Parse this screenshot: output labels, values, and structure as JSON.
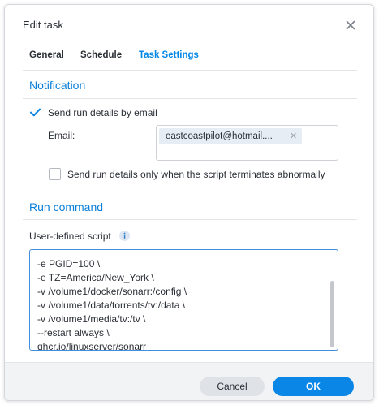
{
  "dialog": {
    "title": "Edit task"
  },
  "tabs": [
    {
      "label": "General",
      "active": false
    },
    {
      "label": "Schedule",
      "active": false
    },
    {
      "label": "Task Settings",
      "active": true
    }
  ],
  "notification": {
    "section_title": "Notification",
    "send_email_label": "Send run details by email",
    "send_email_checked": true,
    "email_label": "Email:",
    "email_chip": "eastcoastpilot@hotmail....",
    "abnormal_label": "Send run details only when the script terminates abnormally",
    "abnormal_checked": false
  },
  "run_command": {
    "section_title": "Run command",
    "script_label": "User-defined script",
    "script_lines": [
      "-e PGID=100 \\",
      "-e TZ=America/New_York \\",
      "-v /volume1/docker/sonarr:/config \\",
      "-v /volume1/data/torrents/tv:/data \\",
      "-v /volume1/media/tv:/tv \\",
      "--restart always \\",
      "ghcr.io/linuxserver/sonarr"
    ]
  },
  "footer": {
    "cancel_label": "Cancel",
    "ok_label": "OK"
  },
  "colors": {
    "accent": "#0a86e6",
    "section_title": "#0a7fd8",
    "active_tab": "#0086e5",
    "footer_bg": "#f1f3f5"
  },
  "icons": {
    "close": "close-icon",
    "check": "checkmark-icon",
    "info": "info-icon",
    "chip_remove": "remove-chip-icon"
  }
}
